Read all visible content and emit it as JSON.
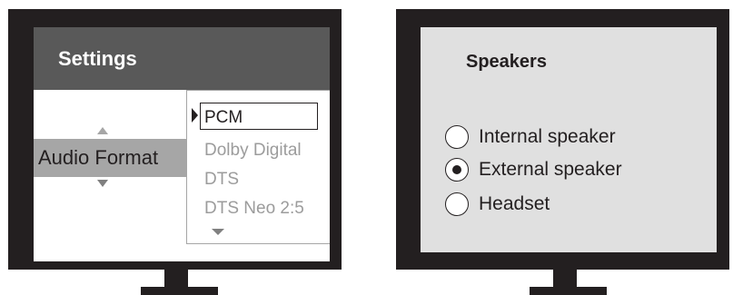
{
  "settings_screen": {
    "title": "Settings",
    "audio_format": {
      "label": "Audio Format",
      "options": [
        "PCM",
        "Dolby Digital",
        "DTS",
        "DTS Neo 2:5"
      ],
      "selected": "PCM"
    }
  },
  "speakers_screen": {
    "title": "Speakers",
    "options": [
      {
        "label": "Internal speaker",
        "selected": false
      },
      {
        "label": "External speaker",
        "selected": true
      },
      {
        "label": "Headset",
        "selected": false
      }
    ]
  },
  "colors": {
    "bezel": "#231f20",
    "header": "#595959",
    "highlight_band": "#a6a6a6",
    "speakers_background": "#e0e0e0",
    "disabled_text": "#9c9c9c"
  }
}
